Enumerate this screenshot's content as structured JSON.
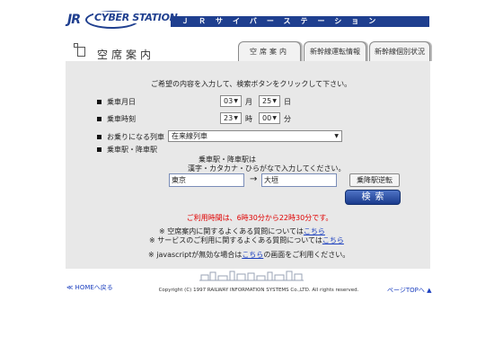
{
  "header": {
    "logo_jr": "JR",
    "logo_cyber": "CYBER STATION",
    "bar_text": "ＪＲサイバーステーション"
  },
  "page": {
    "title": "空席案内"
  },
  "tabs": [
    {
      "label": "空席案内"
    },
    {
      "label": "新幹線運転情報"
    },
    {
      "label": "新幹線個別状況"
    }
  ],
  "form": {
    "intro": "ご希望の内容を入力して、検索ボタンをクリックして下さい。",
    "date_label": "乗車月日",
    "month_value": "03",
    "month_unit": "月",
    "day_value": "25",
    "day_unit": "日",
    "time_label": "乗車時刻",
    "hour_value": "23",
    "hour_unit": "時",
    "minute_value": "00",
    "minute_unit": "分",
    "train_label": "お乗りになる列車",
    "train_value": "在来線列車",
    "station_label": "乗車駅・降車駅",
    "station_note_1": "乗車駅・降車駅は",
    "station_note_2": "漢字・カタカナ・ひらがなで入力してください。",
    "from_station": "東京",
    "arrow": "→",
    "to_station": "大垣",
    "swap_label": "乗降駅逆転",
    "search_label": "検索"
  },
  "notes": {
    "hours": "ご利用時間は、6時30分から22時30分です。",
    "faq1_text": "※ 空席案内に関するよくある質問については",
    "faq1_link": "こちら",
    "faq2_text": "※ サービスのご利用に関するよくある質問については",
    "faq2_link": "こちら",
    "js_text_pre": "※ javascriptが無効な場合は",
    "js_link": "こちら",
    "js_text_post": "の画面をご利用ください。"
  },
  "footer": {
    "home": "≪ HOMEへ戻る",
    "copyright": "Copyright (C) 1997 RAILWAY INFORMATION SYSTEMS Co.,LTD. All rights reserved.",
    "top": "ページTOPへ ▲"
  },
  "colors": {
    "brand": "#1f3f8f",
    "alert": "#e00000",
    "link": "#1b3fbf",
    "panel": "#e8e8e8"
  }
}
